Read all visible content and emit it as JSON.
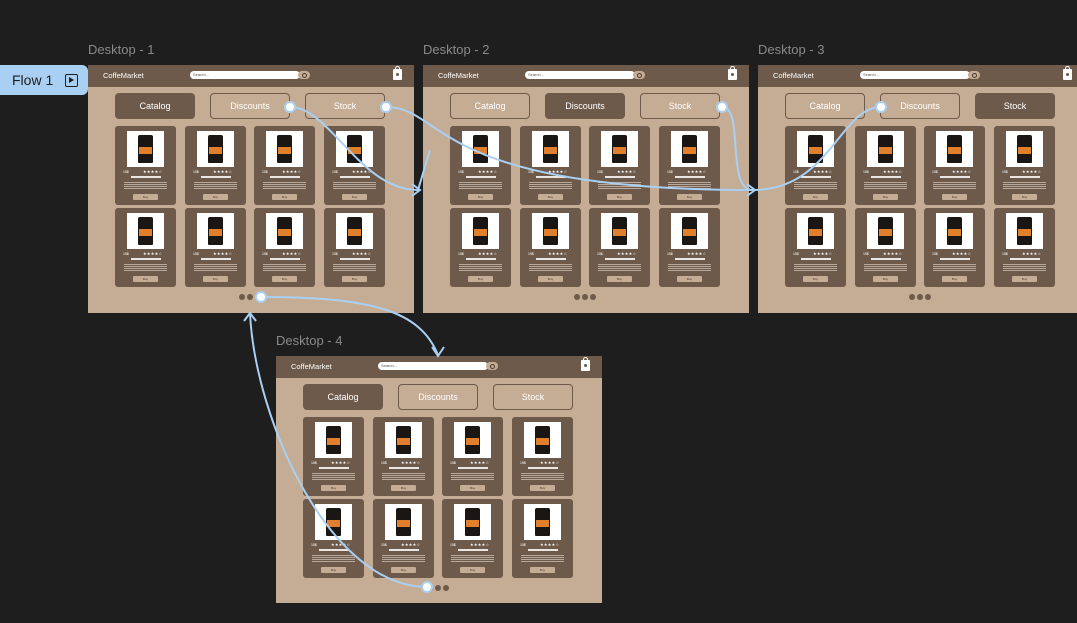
{
  "flow": {
    "label": "Flow 1",
    "icon": "play-frame-icon"
  },
  "frames": [
    {
      "name": "Desktop - 1",
      "active_tab": 0
    },
    {
      "name": "Desktop - 2",
      "active_tab": 1
    },
    {
      "name": "Desktop - 3",
      "active_tab": 2
    },
    {
      "name": "Desktop - 4",
      "active_tab": 0
    }
  ],
  "app": {
    "brand": "CoffeMarket",
    "search_placeholder": "Search...",
    "cart_icon": "shopping-bag-icon",
    "tabs": [
      "Catalog",
      "Discounts",
      "Stock"
    ],
    "product": {
      "price": "15$",
      "rating": "★★★★☆",
      "buy_label": "Buy"
    }
  },
  "colors": {
    "canvas": "#1e1e1e",
    "page": "#c5ac94",
    "dark": "#6d5a4b",
    "connector": "#a9d0f3"
  }
}
